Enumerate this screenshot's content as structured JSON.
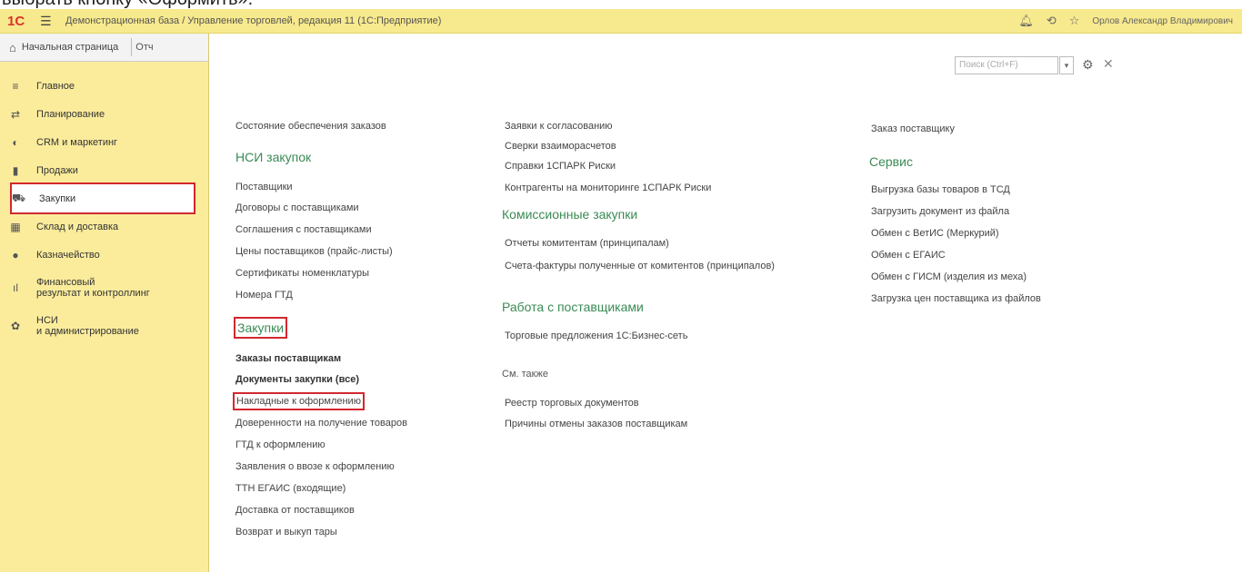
{
  "caption": "выбрать кнопку «Оформить».",
  "titlebar": {
    "logo": "1С",
    "title": "Демонстрационная база / Управление торговлей, редакция 11  (1С:Предприятие)",
    "user": "Орлов Александр Владимирович"
  },
  "tabs": {
    "home": "Начальная страница",
    "next": "Отч"
  },
  "sidebar": {
    "items": [
      {
        "label": "Главное",
        "icon": "≡"
      },
      {
        "label": "Планирование",
        "icon": "⇄"
      },
      {
        "label": "CRM и маркетинг",
        "icon": "◐"
      },
      {
        "label": "Продажи",
        "icon": "▮"
      },
      {
        "label": "Закупки",
        "icon": "⛟"
      },
      {
        "label": "Склад и доставка",
        "icon": "▦"
      },
      {
        "label": "Казначейство",
        "icon": "●"
      },
      {
        "label_1": "Финансовый",
        "label_2": "результат и контроллинг",
        "icon": "ıl"
      },
      {
        "label_1": "НСИ",
        "label_2": "и администрирование",
        "icon": "✿"
      }
    ]
  },
  "search": {
    "placeholder": "Поиск (Ctrl+F)"
  },
  "col1": {
    "top": "Состояние обеспечения заказов",
    "nsi_header": "НСИ закупок",
    "nsi": [
      "Поставщики",
      "Договоры с поставщиками",
      "Соглашения с поставщиками",
      "Цены поставщиков (прайс-листы)",
      "Сертификаты номенклатуры",
      "Номера ГТД"
    ],
    "zak_header": "Закупки",
    "zak_bold": [
      "Заказы поставщикам",
      "Документы закупки (все)"
    ],
    "zak": [
      "Накладные к оформлению",
      "Доверенности на получение товаров",
      "ГТД к оформлению",
      "Заявления о ввозе к оформлению",
      "ТТН ЕГАИС (входящие)",
      "Доставка от поставщиков",
      "Возврат и выкуп тары"
    ]
  },
  "col2": {
    "top": [
      "Заявки к согласованию",
      "Сверки взаиморасчетов",
      "Справки 1СПАРК Риски",
      "Контрагенты на мониторинге 1СПАРК Риски"
    ],
    "kom_header": "Комиссионные закупки",
    "kom": [
      "Отчеты комитентам (принципалам)",
      "Счета-фактуры полученные от комитентов (принципалов)"
    ],
    "rab_header": "Работа с поставщиками",
    "rab": [
      "Торговые предложения 1С:Бизнес-сеть"
    ],
    "see_also": "См. также",
    "see": [
      "Реестр торговых документов",
      "Причины отмены заказов поставщикам"
    ]
  },
  "col3": {
    "top": "Заказ поставщику",
    "srv_header": "Сервис",
    "srv": [
      "Выгрузка базы товаров в ТСД",
      "Загрузить документ из файла",
      "Обмен с ВетИС (Меркурий)",
      "Обмен с ЕГАИС",
      "Обмен с ГИСМ (изделия из меха)",
      "Загрузка цен поставщика из файлов"
    ]
  }
}
